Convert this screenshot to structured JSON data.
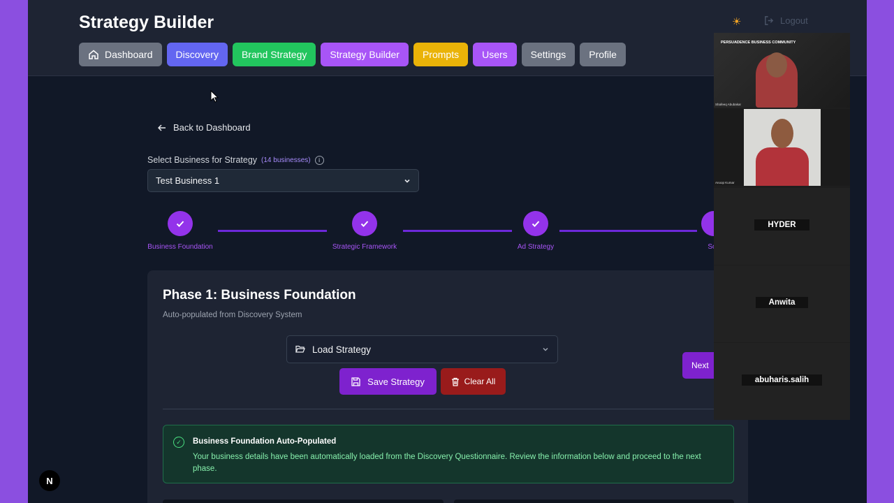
{
  "header": {
    "title": "Strategy Builder",
    "logout_label": "Logout",
    "nav": [
      {
        "label": "Dashboard",
        "color": "#6b7280",
        "icon": "home-icon"
      },
      {
        "label": "Discovery",
        "color": "#6366f1"
      },
      {
        "label": "Brand Strategy",
        "color": "#22c55e"
      },
      {
        "label": "Strategy Builder",
        "color": "#a855f7"
      },
      {
        "label": "Prompts",
        "color": "#eab308"
      },
      {
        "label": "Users",
        "color": "#a855f7"
      },
      {
        "label": "Settings",
        "color": "#6b7280"
      },
      {
        "label": "Profile",
        "color": "#6b7280"
      }
    ]
  },
  "back_label": "Back to Dashboard",
  "business_select": {
    "label": "Select Business for Strategy",
    "count": "(14 businesses)",
    "value": "Test Business 1"
  },
  "steps": [
    {
      "label": "Business Foundation"
    },
    {
      "label": "Strategic Framework"
    },
    {
      "label": "Ad Strategy"
    },
    {
      "label": "Soc"
    }
  ],
  "phase": {
    "title": "Phase 1: Business Foundation",
    "subtitle": "Auto-populated from Discovery System",
    "load_label": "Load Strategy",
    "save_label": "Save Strategy",
    "clear_label": "Clear All",
    "next_label": "Next"
  },
  "banner": {
    "title": "Business Foundation Auto-Populated",
    "text": "Your business details have been automatically loaded from the Discovery Questionnaire. Review the information below and proceed to the next phase."
  },
  "video_call": {
    "participants": [
      {
        "name": "Shafeeq Abubakar",
        "banner": "PERSUADENCE BUSINESS COMMUNITY"
      },
      {
        "name": "Anoop Kumar"
      },
      {
        "name": "HYDER"
      },
      {
        "name": "Anwita"
      },
      {
        "name": "abuharis.salih"
      }
    ]
  },
  "next_logo": "N"
}
